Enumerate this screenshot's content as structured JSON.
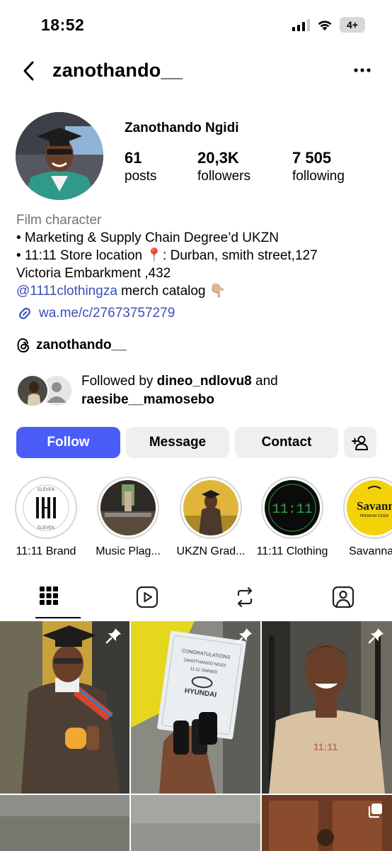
{
  "status_bar": {
    "time": "18:52",
    "battery": "4+"
  },
  "header": {
    "username": "zanothando__"
  },
  "profile": {
    "display_name": "Zanothando Ngidi",
    "stats": [
      {
        "value": "61",
        "label": "posts"
      },
      {
        "value": "20,3K",
        "label": "followers"
      },
      {
        "value": "7 505",
        "label": "following"
      }
    ]
  },
  "bio": {
    "category": "Film character",
    "line1": "• Marketing & Supply Chain Degree’d UKZN",
    "line2": "• 11:11 Store location 📍: Durban, smith street,127",
    "line3": "Victoria Embarkment ,432",
    "mention": "@1111clothingza",
    "mention_suffix": " merch catalog 👇🏼",
    "url": "wa.me/c/27673757279"
  },
  "threads": {
    "handle": "zanothando__"
  },
  "followed_by": {
    "prefix": "Followed by ",
    "user1": "dineo_ndlovu8",
    "joiner": " and",
    "user2": "raesibe__mamosebo"
  },
  "actions": {
    "follow": "Follow",
    "message": "Message",
    "contact": "Contact"
  },
  "highlights": [
    {
      "label": "11:11 Brand"
    },
    {
      "label": "Music Plag..."
    },
    {
      "label": "UKZN Grad..."
    },
    {
      "label": "11:11 Clothing"
    },
    {
      "label": "Savanna I"
    }
  ],
  "highlight_art": {
    "eleven_text": "ELEVEN",
    "clock_text": "11:11",
    "savanna_text": "Savann",
    "savanna_sub": "PREMIUM CIDER"
  },
  "posts": {
    "congrats_text": "CONGRATULATIONS",
    "congrats_name": "ZANOTHANDO NGIDI",
    "congrats_role": "11:11 OWNER",
    "brand": "HYUNDAI",
    "shirt_text": "11:11"
  },
  "colors": {
    "follow_button": "#4a5df9",
    "link_blue": "#3b4fb8",
    "secondary_button": "#efefef",
    "category_grey": "#737373"
  },
  "icons": {
    "back": "chevron-left-icon",
    "more": "more-horizontal-icon",
    "link": "link-icon",
    "threads": "threads-icon",
    "add_user": "add-user-icon",
    "tab_grid": "grid-icon",
    "tab_reels": "reels-icon",
    "tab_reposts": "repost-icon",
    "tab_tagged": "tagged-icon",
    "pin": "pin-icon",
    "carousel": "carousel-icon"
  }
}
